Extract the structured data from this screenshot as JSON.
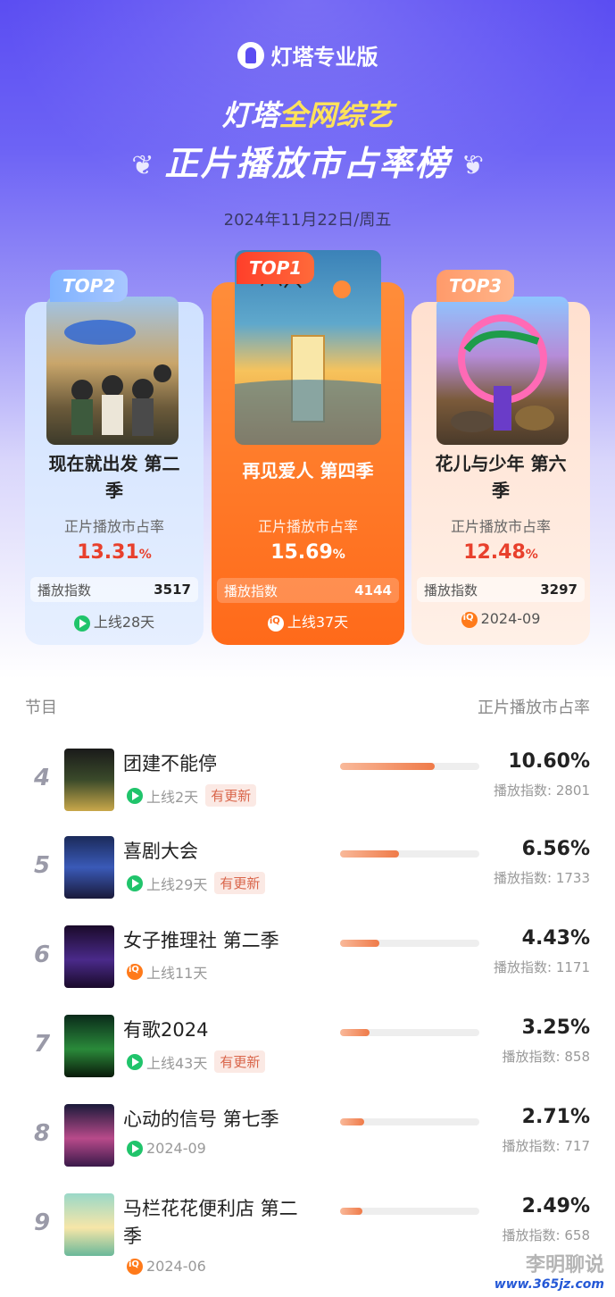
{
  "header": {
    "brand": "灯塔专业版",
    "title_part1": "灯塔",
    "title_highlight": "全网综艺",
    "subtitle": "正片播放市占率榜",
    "date": "2024年11月22日/周五"
  },
  "top3": [
    {
      "badge": "TOP2",
      "name_line1": "现在就出发 第二",
      "name_line2": "季",
      "metric_label": "正片播放市占率",
      "share": "13.31",
      "percent": "%",
      "index_label": "播放指数",
      "index": "3517",
      "platform_icon": "play-icon",
      "footer": "上线28天"
    },
    {
      "badge": "TOP1",
      "name_line1": "再见爱人 第四季",
      "name_line2": "",
      "metric_label": "正片播放市占率",
      "share": "15.69",
      "percent": "%",
      "index_label": "播放指数",
      "index": "4144",
      "platform_icon": "iqiyi-icon",
      "footer": "上线37天"
    },
    {
      "badge": "TOP3",
      "name_line1": "花儿与少年 第六",
      "name_line2": "季",
      "metric_label": "正片播放市占率",
      "share": "12.48",
      "percent": "%",
      "index_label": "播放指数",
      "index": "3297",
      "platform_icon": "iqiyi-icon",
      "footer": "2024-09"
    }
  ],
  "list_header": {
    "left": "节目",
    "right": "正片播放市占率"
  },
  "list": [
    {
      "rank": "4",
      "name": "团建不能停",
      "name_line2": "",
      "meta": "上线2天",
      "tag": "有更新",
      "platform_icon": "play-icon",
      "share": "10.60%",
      "share_fraction": 0.106,
      "index_text": "播放指数: 2801"
    },
    {
      "rank": "5",
      "name": "喜剧大会",
      "name_line2": "",
      "meta": "上线29天",
      "tag": "有更新",
      "platform_icon": "play-icon",
      "share": "6.56%",
      "share_fraction": 0.0656,
      "index_text": "播放指数: 1733"
    },
    {
      "rank": "6",
      "name": "女子推理社 第二季",
      "name_line2": "",
      "meta": "上线11天",
      "tag": "",
      "platform_icon": "iqiyi-icon",
      "share": "4.43%",
      "share_fraction": 0.0443,
      "index_text": "播放指数: 1171"
    },
    {
      "rank": "7",
      "name": "有歌2024",
      "name_line2": "",
      "meta": "上线43天",
      "tag": "有更新",
      "platform_icon": "play-icon",
      "share": "3.25%",
      "share_fraction": 0.0325,
      "index_text": "播放指数: 858"
    },
    {
      "rank": "8",
      "name": "心动的信号 第七季",
      "name_line2": "",
      "meta": "2024-09",
      "tag": "",
      "platform_icon": "play-icon",
      "share": "2.71%",
      "share_fraction": 0.0271,
      "index_text": "播放指数: 717"
    },
    {
      "rank": "9",
      "name": "马栏花花便利店 第二",
      "name_line2": "季",
      "meta": "2024-06",
      "tag": "",
      "platform_icon": "iqiyi-icon",
      "share": "2.49%",
      "share_fraction": 0.0249,
      "index_text": "播放指数: 658"
    }
  ],
  "watermark": {
    "line1": "李明聊说",
    "line2": "www.365jz.com"
  },
  "colors": {
    "accent": "#5b4df2",
    "top1": "#ff6a1a",
    "share_red": "#e8402c",
    "bar_fill": "#ef7a48"
  }
}
